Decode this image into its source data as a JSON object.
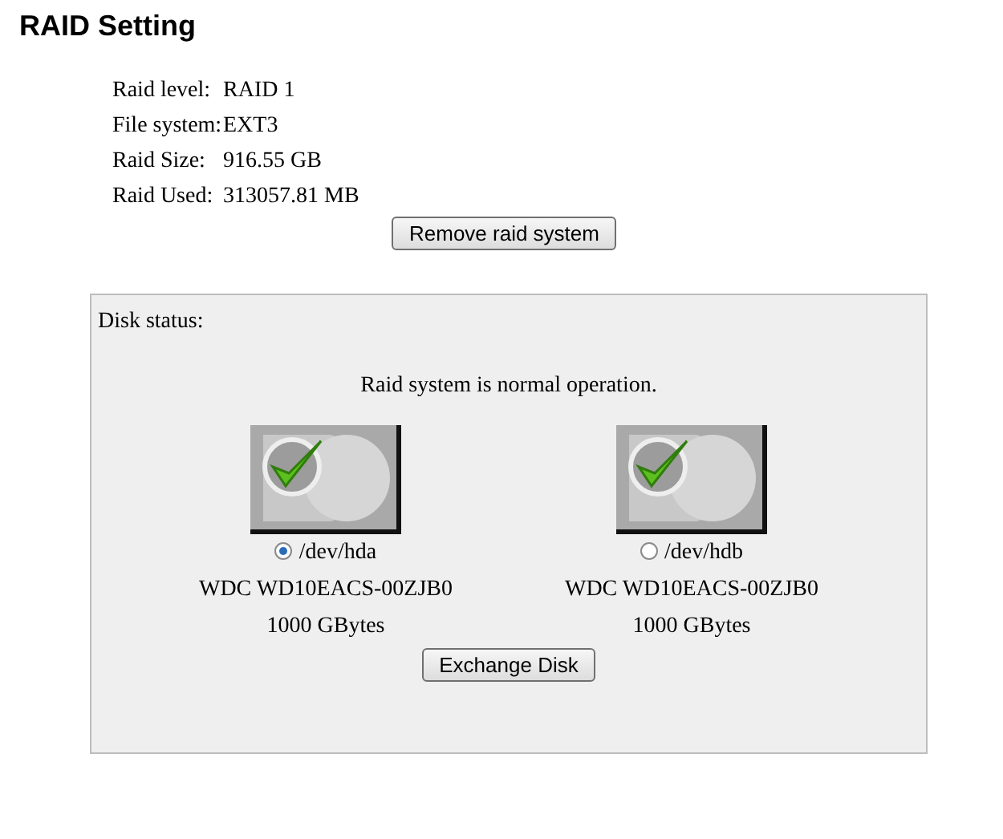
{
  "title": "RAID Setting",
  "info": [
    {
      "label": "Raid level:",
      "value": "RAID 1"
    },
    {
      "label": "File system:",
      "value": "EXT3"
    },
    {
      "label": "Raid Size:",
      "value": "916.55 GB"
    },
    {
      "label": "Raid Used:",
      "value": "313057.81 MB"
    }
  ],
  "remove_button": "Remove raid system",
  "disk_status": {
    "heading": "Disk status:",
    "message": "Raid system is normal operation.",
    "disks": [
      {
        "device": "/dev/hda",
        "selected": true,
        "model": "WDC WD10EACS-00ZJB0",
        "capacity": "1000 GBytes"
      },
      {
        "device": "/dev/hdb",
        "selected": false,
        "model": "WDC WD10EACS-00ZJB0",
        "capacity": "1000 GBytes"
      }
    ],
    "exchange_button": "Exchange Disk"
  }
}
